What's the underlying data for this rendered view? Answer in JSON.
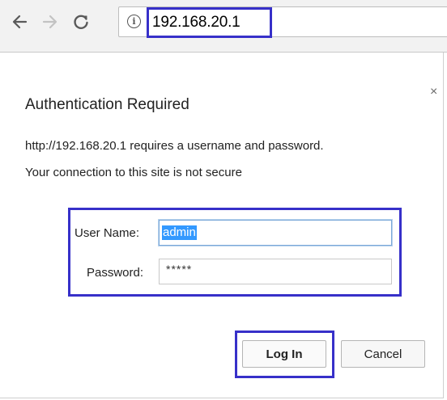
{
  "browser": {
    "url": "192.168.20.1",
    "icons": {
      "back": "back-arrow-icon",
      "forward": "forward-arrow-icon",
      "reload": "reload-icon",
      "site_info": "info-icon"
    },
    "highlight_color": "#3730c9"
  },
  "dialog": {
    "title": "Authentication Required",
    "message": "http://192.168.20.1 requires a username and password.",
    "warning": "Your connection to this site is not secure",
    "fields": {
      "username_label": "User Name:",
      "username_value": "admin",
      "password_label": "Password:",
      "password_mask": "*****"
    },
    "buttons": {
      "login": "Log In",
      "cancel": "Cancel"
    },
    "close_glyph": "×"
  }
}
